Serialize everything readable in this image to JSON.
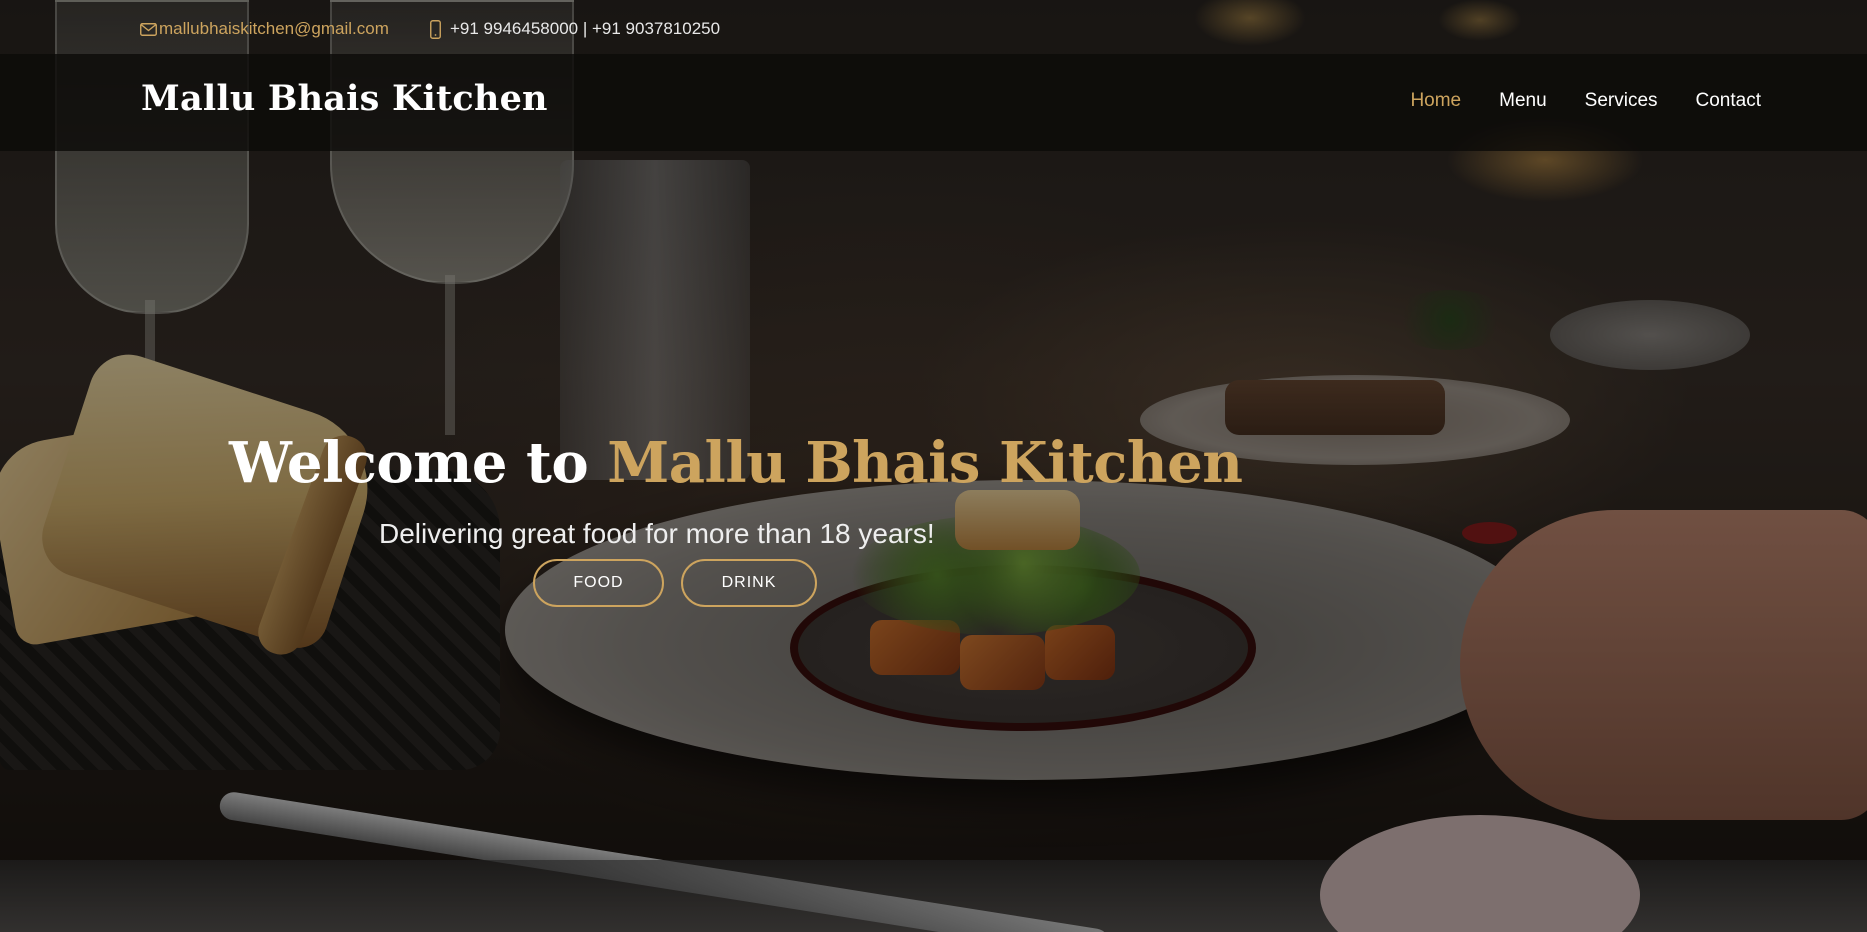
{
  "topbar": {
    "email": "mallubhaiskitchen@gmail.com",
    "phone": "+91 9946458000 | +91 9037810250",
    "email_icon": "envelope-icon",
    "phone_icon": "mobile-phone-icon"
  },
  "header": {
    "logo": "Mallu Bhais Kitchen",
    "nav": [
      {
        "label": "Home",
        "active": true
      },
      {
        "label": "Menu",
        "active": false
      },
      {
        "label": "Services",
        "active": false
      },
      {
        "label": "Contact",
        "active": false
      }
    ]
  },
  "hero": {
    "title_prefix": "Welcome to ",
    "title_brand": "Mallu Bhais Kitchen",
    "subtitle": "Delivering great food for more than 18 years!",
    "buttons": {
      "food": "FOOD",
      "drink": "DRINK"
    }
  },
  "colors": {
    "accent": "#cda45e",
    "text": "#ffffff",
    "header_bg": "#0c0b09"
  }
}
